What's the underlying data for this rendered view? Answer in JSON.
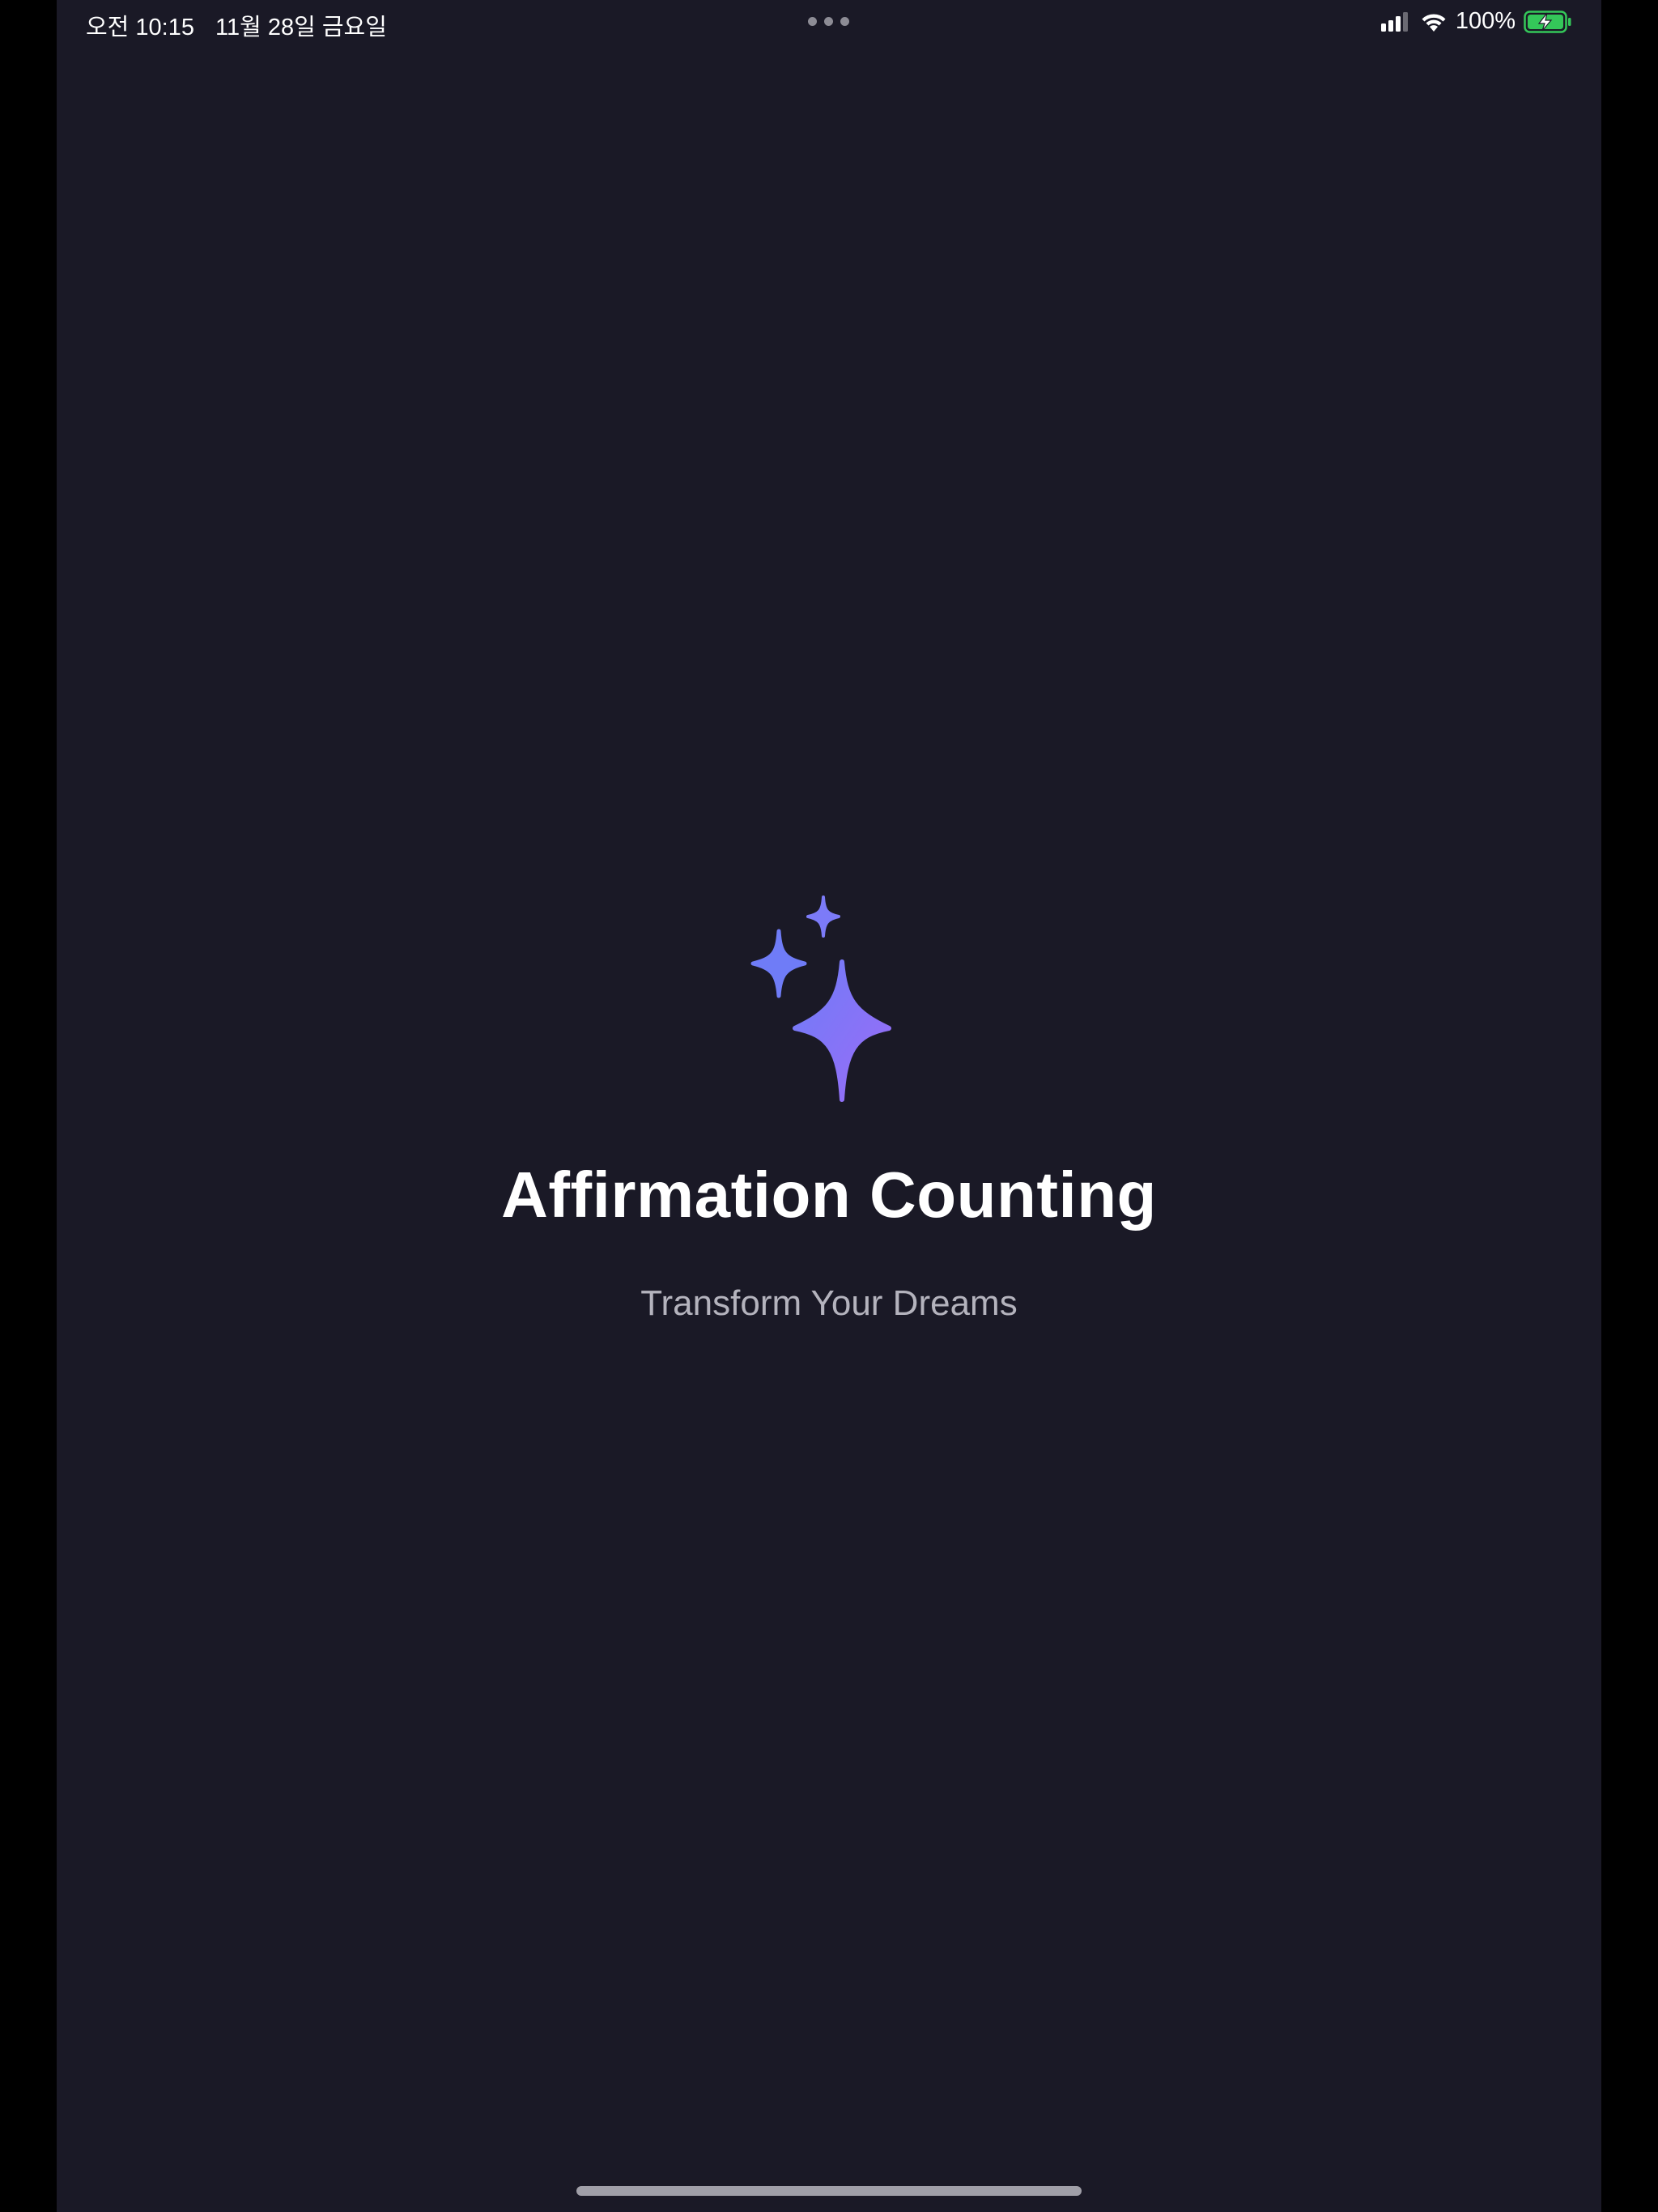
{
  "status_bar": {
    "time": "오전 10:15",
    "date": "11월 28일 금요일",
    "battery_percent": "100%",
    "signal_icon": "cellular-signal-icon",
    "wifi_icon": "wifi-icon",
    "battery_icon": "battery-charging-icon",
    "multitasking_icon": "three-dots-icon"
  },
  "main": {
    "icon": "sparkles-icon",
    "title": "Affirmation Counting",
    "subtitle": "Transform Your Dreams"
  },
  "colors": {
    "background": "#1a1926",
    "accent_start": "#6f7cf7",
    "accent_end": "#9a6cf7",
    "battery_green": "#34c759",
    "text_primary": "#ffffff",
    "text_secondary": "#b4b3bd"
  }
}
